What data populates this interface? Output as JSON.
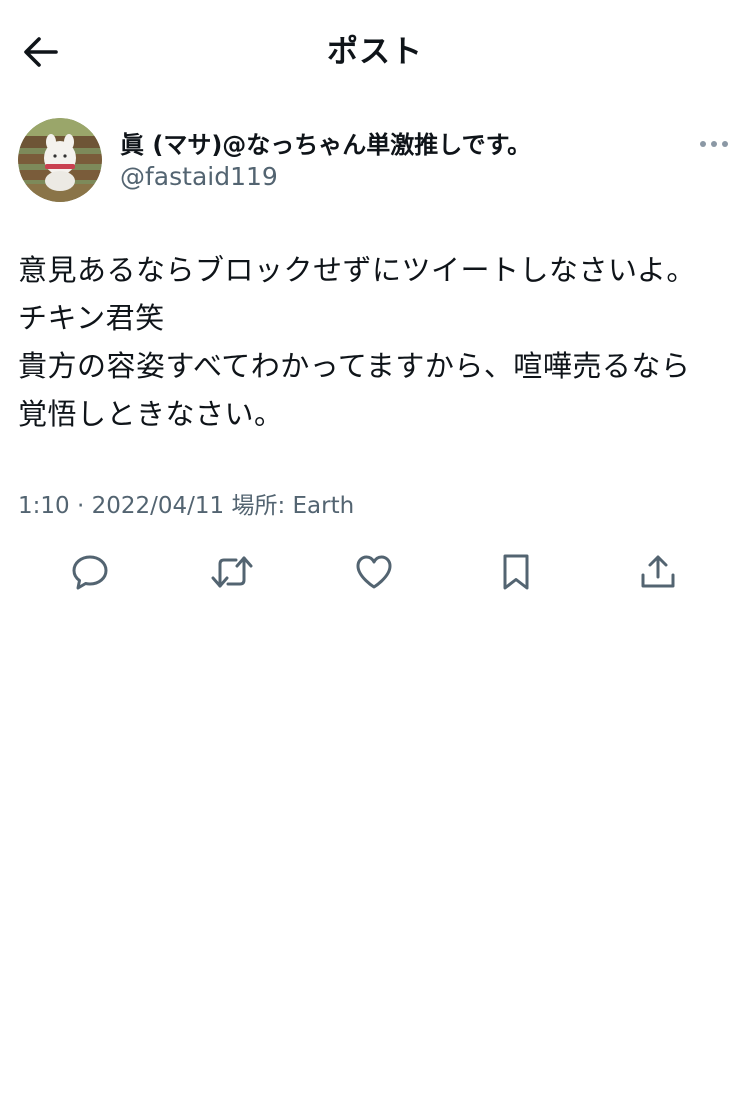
{
  "header": {
    "title": "ポスト",
    "back_icon": "arrow-left-icon"
  },
  "post": {
    "author": {
      "display_name": "眞 (マサ)@なっちゃん単激推しです。",
      "handle": "@fastaid119",
      "avatar_icon": "avatar-photo"
    },
    "more_icon": "more-horizontal-icon",
    "text_lines": [
      "意見あるならブロックせずにツイートしなさいよ。",
      "チキン君笑",
      "貴方の容姿すべてわかってますから、喧嘩売るなら",
      "覚悟しときなさい。"
    ],
    "meta": "1:10 · 2022/04/11 場所: Earth",
    "actions": [
      {
        "icon": "reply-icon"
      },
      {
        "icon": "repost-icon"
      },
      {
        "icon": "like-icon"
      },
      {
        "icon": "bookmark-icon"
      },
      {
        "icon": "share-icon"
      }
    ]
  },
  "colors": {
    "text": "#0f1419",
    "secondary": "#536471",
    "background": "#ffffff"
  }
}
